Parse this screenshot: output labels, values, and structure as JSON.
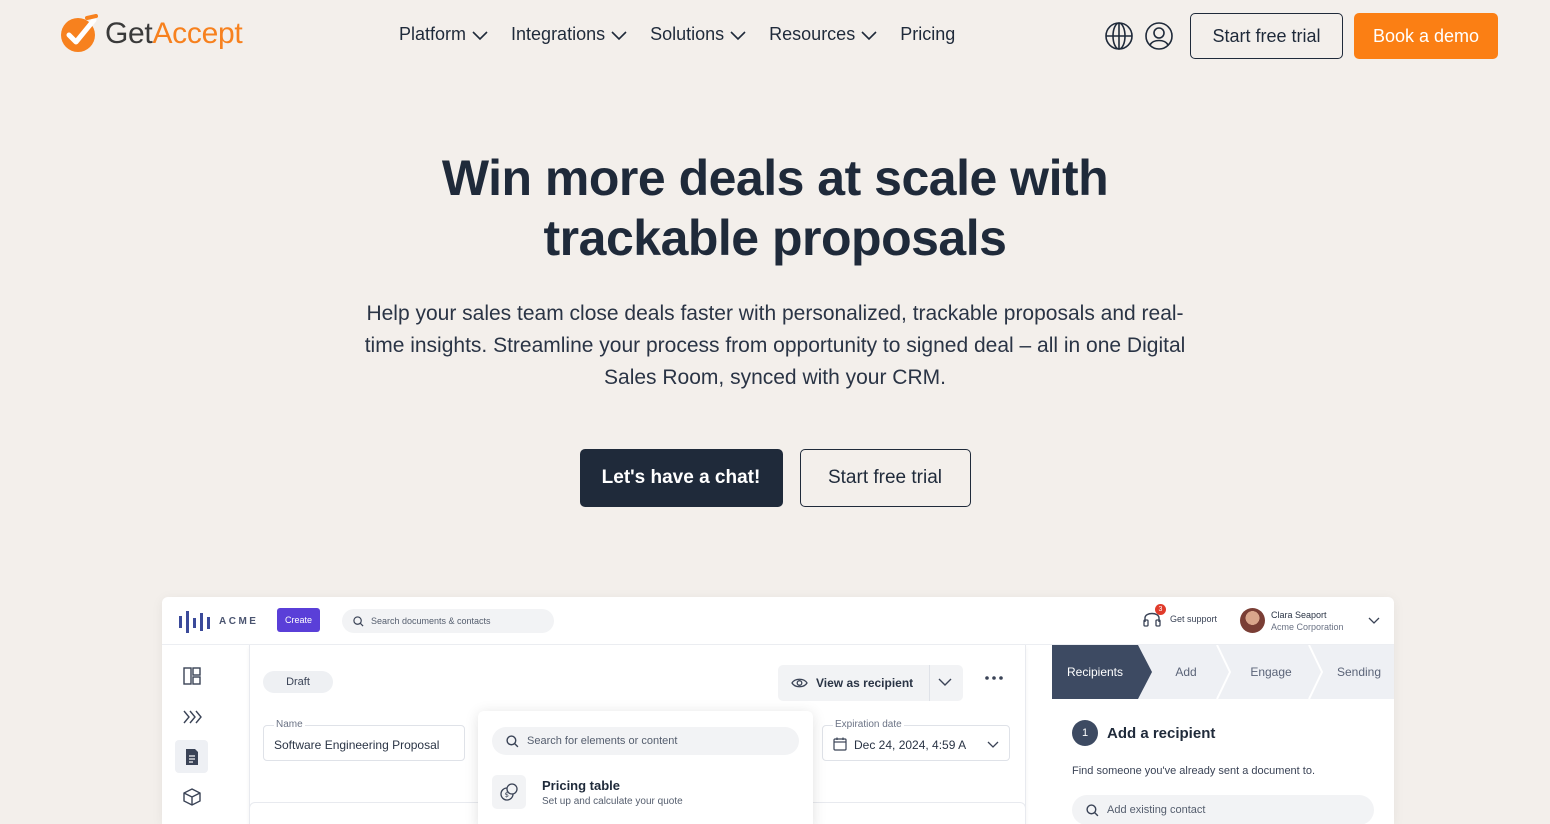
{
  "brand": {
    "logo_get": "Get",
    "logo_accept": "Accept",
    "orange": "#fb7f14",
    "dark": "#1f2a3a"
  },
  "nav": {
    "items": [
      {
        "label": "Platform",
        "dropdown": true
      },
      {
        "label": "Integrations",
        "dropdown": true
      },
      {
        "label": "Solutions",
        "dropdown": true
      },
      {
        "label": "Resources",
        "dropdown": true
      },
      {
        "label": "Pricing",
        "dropdown": false
      }
    ],
    "trial_label": "Start free trial",
    "demo_label": "Book a demo",
    "icons": [
      "globe-icon",
      "user-icon"
    ]
  },
  "hero": {
    "title_line1": "Win more deals at scale with",
    "title_line2": "trackable proposals",
    "subtitle": "Help your sales team close deals faster with personalized, trackable proposals and real-time insights. Streamline your process from opportunity to signed deal – all in one Digital Sales Room, synced with your CRM.",
    "chat_label": "Let's have a chat!",
    "trial_label": "Start free trial"
  },
  "app": {
    "logo_text": "ACME",
    "create_label": "Create",
    "search_placeholder": "Search documents & contacts",
    "support_label": "Get support",
    "support_badge": "3",
    "user_name": "Clara Seaport",
    "user_org": "Acme Corporation",
    "draft_label": "Draft",
    "view_recipient_label": "View as recipient",
    "name_label": "Name",
    "name_value": "Software Engineering Proposal",
    "expiration_label": "Expiration date",
    "expiration_value": "Dec 24, 2024, 4:59 A",
    "element_search_placeholder": "Search for elements or content",
    "pricing_title": "Pricing table",
    "pricing_desc": "Set up and calculate your quote",
    "steps": [
      "Recipients",
      "Add",
      "Engage",
      "Sending"
    ],
    "add_recipient_num": "1",
    "add_recipient_title": "Add a recipient",
    "find_text": "Find someone you've already sent a document to.",
    "contact_placeholder": "Add existing contact"
  }
}
